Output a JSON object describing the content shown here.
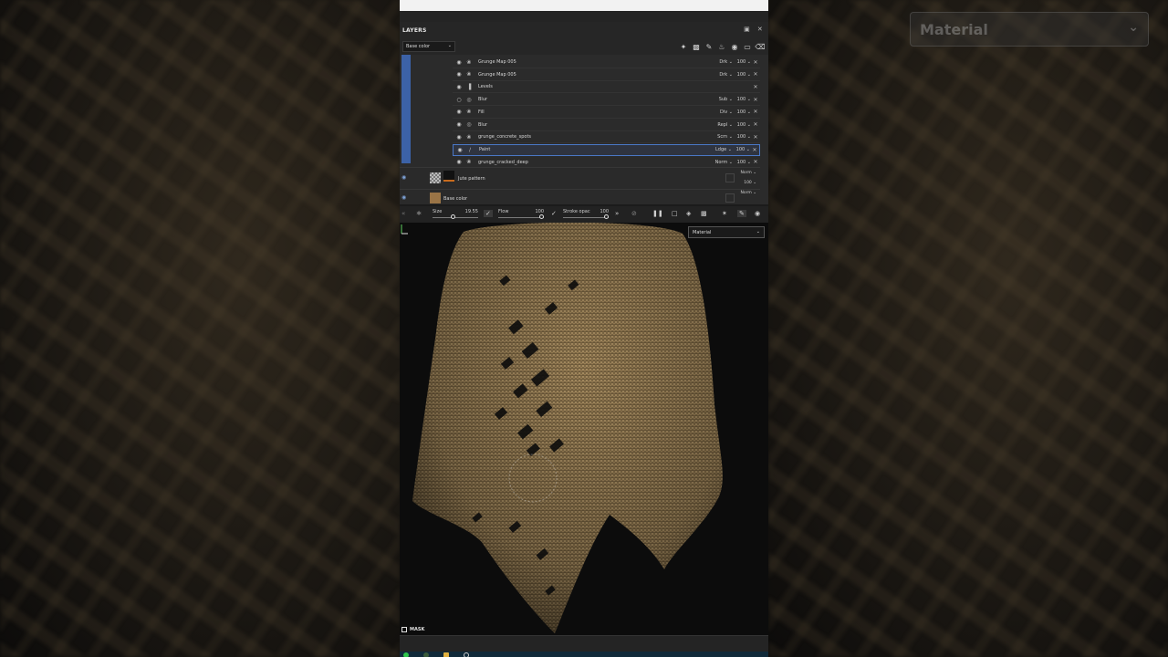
{
  "panel": {
    "title": "LAYERS",
    "channel_select": "Base color"
  },
  "effects": [
    {
      "name": "Grunge Map 005",
      "icon": "fill-bucket-icon",
      "blend": "Drk",
      "opacity": "100",
      "selected": false
    },
    {
      "name": "Grunge Map 005",
      "icon": "fill-bucket-icon",
      "blend": "Drk",
      "opacity": "100",
      "selected": false
    },
    {
      "name": "Levels",
      "icon": "levels-icon",
      "blend": "",
      "opacity": "",
      "selected": false
    },
    {
      "name": "Blur",
      "icon": "filter-icon",
      "blend": "Sub",
      "opacity": "100",
      "selected": false
    },
    {
      "name": "Fill",
      "icon": "fill-bucket-icon",
      "blend": "Div",
      "opacity": "100",
      "selected": false
    },
    {
      "name": "Blur",
      "icon": "filter-icon",
      "blend": "Repl",
      "opacity": "100",
      "selected": false
    },
    {
      "name": "grunge_concrete_spots",
      "icon": "fill-bucket-icon",
      "blend": "Scrn",
      "opacity": "100",
      "selected": false
    },
    {
      "name": "Paint",
      "icon": "brush-icon",
      "blend": "Ldge",
      "opacity": "100",
      "selected": true
    },
    {
      "name": "grunge_cracked_deep",
      "icon": "fill-bucket-icon",
      "blend": "Norm",
      "opacity": "100",
      "selected": false
    }
  ],
  "layers": [
    {
      "name": "Jute pattern",
      "blend": "Norm",
      "opacity": "100"
    },
    {
      "name": "Base color",
      "blend": "Norm",
      "opacity": ""
    }
  ],
  "brush": {
    "size_label": "Size",
    "size_value": "19.55",
    "size_level": 0.45,
    "flow_label": "Flow",
    "flow_value": "100",
    "flow_level": 1.0,
    "stroke_label": "Stroke opac",
    "stroke_value": "100",
    "stroke_level": 1.0
  },
  "viewport": {
    "material_select": "Material",
    "mask_label": "MASK"
  },
  "colors": {
    "accent": "#3c62a7",
    "cloth": "#8a7350",
    "background": "#0c0c0c"
  },
  "background_overlay": {
    "select_text": "Material"
  }
}
